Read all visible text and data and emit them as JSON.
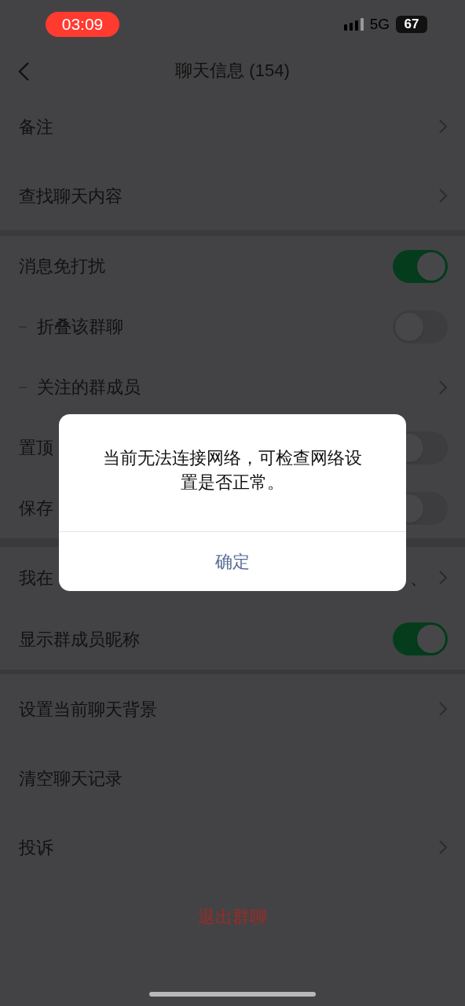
{
  "status_bar": {
    "time": "03:09",
    "network": "5G",
    "battery": "67"
  },
  "header": {
    "title": "聊天信息 (154)"
  },
  "sections": [
    {
      "rows": [
        {
          "label": "备注",
          "kind": "link"
        },
        {
          "label": "查找聊天内容",
          "kind": "link"
        }
      ]
    },
    {
      "rows": [
        {
          "label": "消息免打扰",
          "kind": "toggle",
          "on": true,
          "children": [
            {
              "label": "折叠该群聊",
              "kind": "toggle",
              "on": false
            },
            {
              "label": "关注的群成员",
              "kind": "link"
            }
          ]
        },
        {
          "label": "置顶",
          "kind": "toggle",
          "on": false
        },
        {
          "label": "保存",
          "kind": "toggle",
          "on": false
        }
      ]
    },
    {
      "rows": [
        {
          "label": "我在",
          "kind": "link",
          "value": "、"
        },
        {
          "label": "显示群成员昵称",
          "kind": "toggle",
          "on": true
        }
      ]
    },
    {
      "rows": [
        {
          "label": "设置当前聊天背景",
          "kind": "link"
        },
        {
          "label": "清空聊天记录",
          "kind": "plain"
        },
        {
          "label": "投诉",
          "kind": "link"
        }
      ]
    }
  ],
  "leave_button": "退出群聊",
  "dialog": {
    "message": "当前无法连接网络，可检查网络设置是否正常。",
    "button": "确定"
  }
}
